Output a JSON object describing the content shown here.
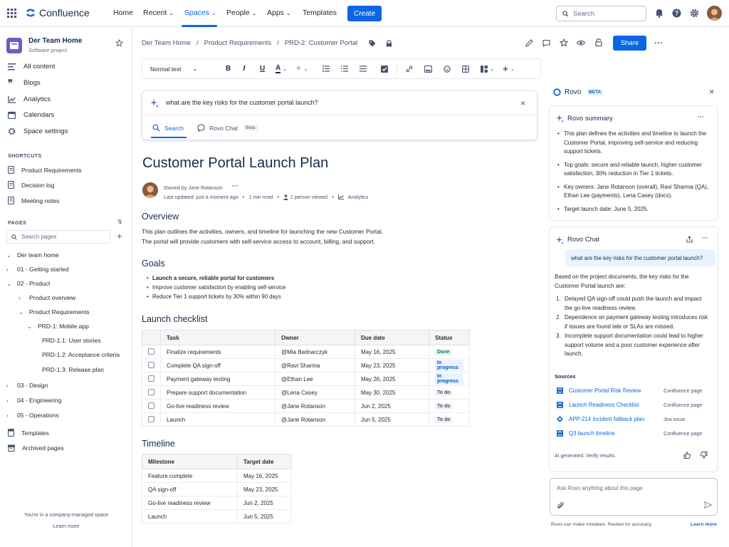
{
  "topbar": {
    "logo": "Confluence",
    "nav": [
      "Home",
      "Recent",
      "Spaces",
      "People",
      "Apps",
      "Templates"
    ],
    "create": "Create",
    "search_placeholder": "Search"
  },
  "sidebar": {
    "space_name": "Der Team Home",
    "space_type": "Software project",
    "items": [
      "All content",
      "Blogs",
      "Analytics",
      "Calendars",
      "Space settings"
    ],
    "shortcuts_header": "SHORTCUTS",
    "shortcuts": [
      "Product Requirements",
      "Decision log",
      "Meeting notes"
    ],
    "pages_header": "PAGES",
    "search_pages": "Search pages",
    "tree": [
      "Der team home",
      "01 - Getting started",
      "02 - Product",
      "Product overview",
      "Product Requirements",
      "PRD-1: Mobile app",
      "PRD-1.1: User stories",
      "PRD-1.2: Acceptance criteria",
      "PRD-1.3: Release plan",
      "03 - Design",
      "04 - Engineering",
      "05 - Operations"
    ],
    "templates": "Templates",
    "archived": "Archived pages",
    "footer_text": "You're in a company-managed space",
    "learn_more": "Learn more"
  },
  "breadcrumb": [
    "Der Team Home",
    "Product Requirements",
    "PRD-2: Customer Portal"
  ],
  "share": "Share",
  "toolbar": {
    "text_style": "Normal text"
  },
  "rovo_search": {
    "query": "what are the key risks for the customer portal launch?",
    "tab_search": "Search",
    "tab_chat": "Rovo Chat",
    "beta": "Beta"
  },
  "page": {
    "title": "Customer Portal Launch Plan",
    "owner": "Owned by Jane Rotanson",
    "updated": "Last updated: just a moment ago",
    "read": "1 min read",
    "viewed": "1 person viewed",
    "analytics": "Analytics",
    "overview_h": "Overview",
    "overview_1": "This plan outlines the activities, owners, and timeline for launching the new Customer Portal.",
    "overview_2": "The portal will provide customers with self-service access to account, billing, and support.",
    "goals_h": "Goals",
    "goals": [
      "Launch a secure, reliable portal for customers",
      "Improve customer satisfaction by enabling self-service",
      "Reduce Tier 1 support tickets by 30% within 90 days"
    ],
    "checklist_h": "Launch checklist",
    "checklist_cols": [
      "Task",
      "Owner",
      "Due date",
      "Status"
    ],
    "checklist": [
      {
        "task": "Finalize requirements",
        "owner": "@Mia Bednarczyk",
        "due": "May 16, 2025",
        "status": "Done"
      },
      {
        "task": "Complete QA sign-off",
        "owner": "@Ravi Sharma",
        "due": "May 23, 2025",
        "status": "In progress"
      },
      {
        "task": "Payment gateway testing",
        "owner": "@Ethan Lee",
        "due": "May 26, 2025",
        "status": "In progress"
      },
      {
        "task": "Prepare support documentation",
        "owner": "@Lena Casey",
        "due": "May 30, 2025",
        "status": "To do"
      },
      {
        "task": "Go-live readiness review",
        "owner": "@Jane Rotanson",
        "due": "Jun 2, 2025",
        "status": "To do"
      },
      {
        "task": "Launch",
        "owner": "@Jane Rotanson",
        "due": "Jun 5, 2025",
        "status": "To do"
      }
    ],
    "status_colors": {
      "Done": [
        "#dcfff1",
        "#216e4e"
      ],
      "In progress": [
        "#e9f2ff",
        "#0055cc"
      ],
      "To do": [
        "#f1f2f4",
        "#44546f"
      ]
    },
    "timeline_h": "Timeline",
    "timeline_cols": [
      "Milestone",
      "Target date"
    ],
    "timeline": [
      {
        "m": "Feature complete",
        "d": "May 16, 2025"
      },
      {
        "m": "QA sign-off",
        "d": "May 23, 2025"
      },
      {
        "m": "Go-live readiness review",
        "d": "Jun 2, 2025"
      },
      {
        "m": "Launch",
        "d": "Jun 5, 2025"
      }
    ]
  },
  "rovo": {
    "title": "Rovo",
    "beta": "BETA",
    "summary_title": "Rovo summary",
    "summary": [
      "This plan defines the activities and timeline to launch the Customer Portal, improving self-service and reducing support tickets.",
      "Top goals: secure and reliable launch, higher customer satisfaction, 30% reduction in Tier 1 tickets.",
      "Key owners: Jane Rotanson (overall), Ravi Sharma (QA), Ethan Lee (payments), Lena Casey (docs).",
      "Target launch date: June 5, 2025."
    ],
    "chat_title": "Rovo Chat",
    "user_msg": "what are the key risks for the customer portal launch?",
    "answer_intro": "Based on the project documents, the key risks for the Customer Portal launch are:",
    "risks": [
      "Delayed QA sign-off could push the launch and impact the go-live readiness review.",
      "Dependence on payment gateway testing introduces risk if issues are found late or SLAs are missed.",
      "Incomplete support documentation could lead to higher support volume and a poor customer experience after launch."
    ],
    "sources_h": "Sources",
    "sources": [
      {
        "name": "Customer Portal Risk Review",
        "type": "Confluence page"
      },
      {
        "name": "Launch Readiness Checklist",
        "type": "Confluence page"
      },
      {
        "name": "APP-214 Incident fallback plan",
        "type": "Jira issue"
      },
      {
        "name": "Q3 launch timeline",
        "type": "Confluence page"
      }
    ],
    "ai_note": "AI generated. Verify results.",
    "input_placeholder": "Ask Rovo anything about this page",
    "footer": "Rovo can make mistakes. Review for accuracy.",
    "learn_more": "Learn more"
  }
}
